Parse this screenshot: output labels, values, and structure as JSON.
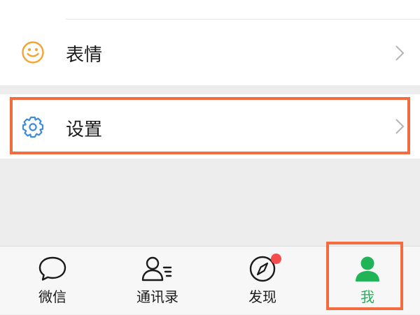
{
  "menu": {
    "items": [
      {
        "label": "表情",
        "icon": "smiley-icon",
        "icon_color": "#f2a533"
      },
      {
        "label": "设置",
        "icon": "gear-icon",
        "icon_color": "#3d8bd9"
      }
    ]
  },
  "tabbar": {
    "tabs": [
      {
        "label": "微信",
        "icon": "chat-bubble-icon",
        "active": false
      },
      {
        "label": "通讯录",
        "icon": "contacts-icon",
        "active": false
      },
      {
        "label": "发现",
        "icon": "compass-icon",
        "active": false,
        "has_badge": true
      },
      {
        "label": "我",
        "icon": "person-icon",
        "active": true
      }
    ]
  },
  "colors": {
    "active_tab": "#21b457",
    "highlight_box": "#f26c3f",
    "badge": "#f54d4d"
  }
}
